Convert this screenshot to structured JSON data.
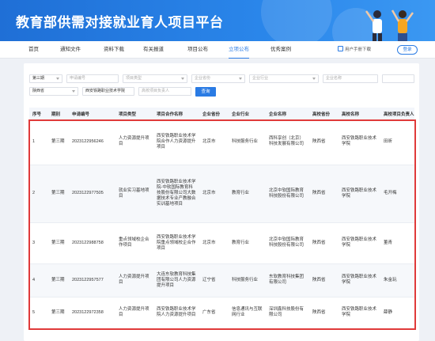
{
  "header": {
    "title": "教育部供需对接就业育人项目平台"
  },
  "nav": {
    "items": [
      "首页",
      "通知文件",
      "资料下载",
      "有关报道",
      "项目公布",
      "立项公布",
      "优秀案例"
    ],
    "active_index": 5,
    "download_label": "用户手册下载",
    "login_label": "登录"
  },
  "filters": {
    "period": "第三期",
    "application_no": "申请编号",
    "project_type": "项目类型",
    "enterprise_province": "企业省份",
    "enterprise_industry": "企业行业",
    "enterprise_name": "企业名称",
    "university_province": "陕西省",
    "university_name": "西安铁路职业技术学院",
    "university_leader": "高校项目负责人",
    "search_label": "查询"
  },
  "table": {
    "headers": [
      "序号",
      "期别",
      "申请编号",
      "项目类型",
      "项目合作名称",
      "企业省份",
      "企业行业",
      "企业名称",
      "高校省份",
      "高校名称",
      "高校项目负责人"
    ],
    "rows": [
      [
        "1",
        "第三期",
        "2023122956246",
        "人力资源提升项目",
        "西安铁路职业技术学院合作人力资源提升项目",
        "北京市",
        "科技服务行业",
        "西科享创（北京）科技发展有限公司",
        "陕西省",
        "西安铁路职业技术学院",
        "田昕"
      ],
      [
        "2",
        "第三期",
        "2023122977505",
        "就业实习基地项目",
        "西安铁路职业技术学院-中软国际教育科技股份有限公司大数据技术专业产教融合实训基地项目",
        "北京市",
        "教育行业",
        "北京中软国际教育科技股份有限公司",
        "陕西省",
        "西安铁路职业技术学院",
        "毛开梅"
      ],
      [
        "3",
        "第三期",
        "2023122988758",
        "重点领域校企合作项目",
        "西安铁路职业技术学院重点领域校企合作项目",
        "北京市",
        "教育行业",
        "北京中软国际教育科技股份有限公司",
        "陕西省",
        "西安铁路职业技术学院",
        "董青"
      ],
      [
        "4",
        "第三期",
        "2023122957577",
        "人力资源提升项目",
        "大连东软教育科技集团有限公司人力资源提升项目",
        "辽宁省",
        "科技服务行业",
        "东软教育科技集团有限公司",
        "陕西省",
        "西安铁路职业技术学院",
        "朱金玩"
      ],
      [
        "5",
        "第三期",
        "2023122972358",
        "人力资源提升项目",
        "西安铁路职业技术学院人力资源提升项目",
        "广东省",
        "信息通讯与互联网行业",
        "深圳鑫科技股份有限公司",
        "陕西省",
        "西安铁路职业技术学院",
        "薛静"
      ]
    ]
  },
  "colors": {
    "primary": "#2a7be4",
    "highlight": "#e03a3a",
    "header_bg": "#1f6fd6"
  }
}
